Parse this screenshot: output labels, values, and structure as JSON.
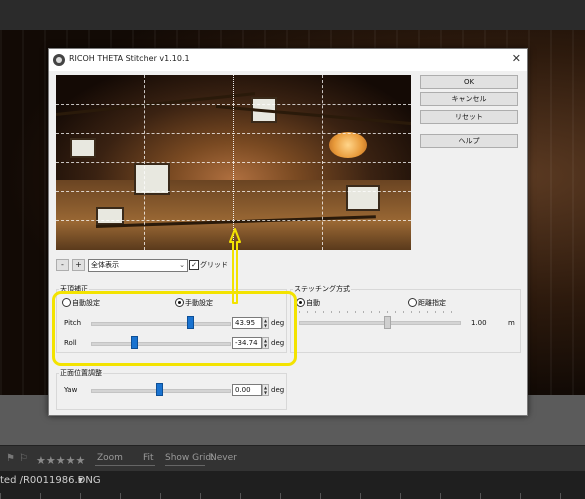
{
  "dialog": {
    "title": "RICOH THETA Stitcher v1.10.1",
    "close_glyph": "✕",
    "buttons": {
      "ok": "OK",
      "cancel": "キャンセル",
      "reset": "リセット",
      "help": "ヘルプ"
    },
    "view": {
      "minus": "-",
      "plus": "+",
      "selected": "全体表示",
      "grid_label": "グリッド",
      "grid_checked": true
    },
    "zenith": {
      "title": "天頂補正",
      "auto_label": "自動設定",
      "manual_label": "手動設定",
      "selected": "manual",
      "pitch_label": "Pitch",
      "pitch_value": "43.95",
      "pitch_unit": "deg",
      "roll_label": "Roll",
      "roll_value": "-34.74",
      "roll_unit": "deg"
    },
    "stitching": {
      "title": "ステッチング方式",
      "auto_label": "自動",
      "distance_label": "距離指定",
      "selected": "auto",
      "distance_value": "1.00",
      "distance_unit": "m"
    },
    "front": {
      "title": "正面位置調整",
      "yaw_label": "Yaw",
      "yaw_value": "0.00",
      "yaw_unit": "deg"
    }
  },
  "background": {
    "stars": "★★★★★",
    "zoom_label": "Zoom",
    "fit_label": "Fit",
    "grid_label": "Show Grid:",
    "grid_value": "Never",
    "filename": "ted /R0011986.DNG",
    "filename_suffix": "▾"
  },
  "colors": {
    "highlight": "#f3e300",
    "slider_thumb": "#1a73d0"
  }
}
